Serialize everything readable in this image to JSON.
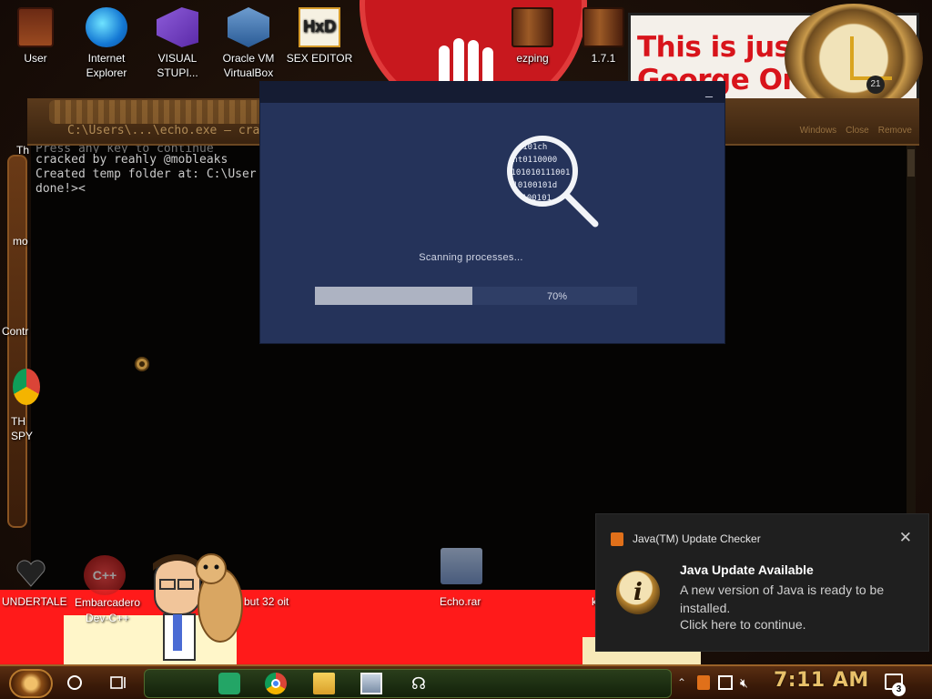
{
  "desktop": {
    "top_icons": [
      {
        "label": "User",
        "icon": "folder-icon"
      },
      {
        "label": "Internet Explorer",
        "icon": "edge-icon"
      },
      {
        "label": "VISUAL STUPI...",
        "icon": "visual-studio-icon"
      },
      {
        "label": "Oracle VM VirtualBox",
        "icon": "virtualbox-icon"
      },
      {
        "label": "SEX EDITOR",
        "icon": "hxd-icon"
      },
      {
        "label": "ezping",
        "icon": "folder-icon"
      },
      {
        "label": "1.7.1",
        "icon": "folder-icon"
      }
    ],
    "left_icons": [
      {
        "label": "Th"
      },
      {
        "label": "mo"
      },
      {
        "label": "Contr"
      },
      {
        "label": "TH SPY"
      }
    ],
    "bottom_icons": [
      {
        "label": "UNDERTALE"
      },
      {
        "label": "Embarcadero Dev-C++"
      },
      {
        "label": "but 32 oit"
      },
      {
        "label": "Echo.rar"
      },
      {
        "label": "k"
      }
    ],
    "wallpaper_banner": {
      "line1": "This is jus",
      "line2": "George Or"
    },
    "wallpaper_clock_badge": "21",
    "hxd_glyph": "HxD"
  },
  "console": {
    "title": "C:\\Users\\...\\echo.exe — crack by realy",
    "tabs": [
      "Windows",
      "Close",
      "Remove"
    ],
    "lines": [
      "Press any key to continue",
      "cracked by reahly @mobleaks",
      "Created temp folder at: C:\\User",
      "done!><"
    ]
  },
  "scanner": {
    "status": "Scanning processes...",
    "progress_percent": 70,
    "progress_label": "70%",
    "minimize_glyph": "_",
    "binary_lines": [
      "010101ch",
      "int0110000",
      "1101010111001",
      "010100101d",
      "0100101"
    ]
  },
  "java_toast": {
    "app_name": "Java(TM) Update Checker",
    "close_glyph": "✕",
    "icon_letter": "i",
    "heading": "Java Update Available",
    "body": "A new version of Java is ready to be installed.",
    "cta": "Click here to continue."
  },
  "taskbar": {
    "clock": "7:11 AM",
    "notification_count": "3",
    "apps": [
      "google-sheets-icon",
      "chrome-icon",
      "file-explorer-icon",
      "screen-capture-icon",
      "echo-icon"
    ]
  },
  "colors": {
    "scanner_bg": "#25335a",
    "scanner_titlebar": "#151c33",
    "progress_fill": "#adb3c2",
    "toast_bg": "#1f1f1f",
    "banner_red": "#d8141b"
  }
}
